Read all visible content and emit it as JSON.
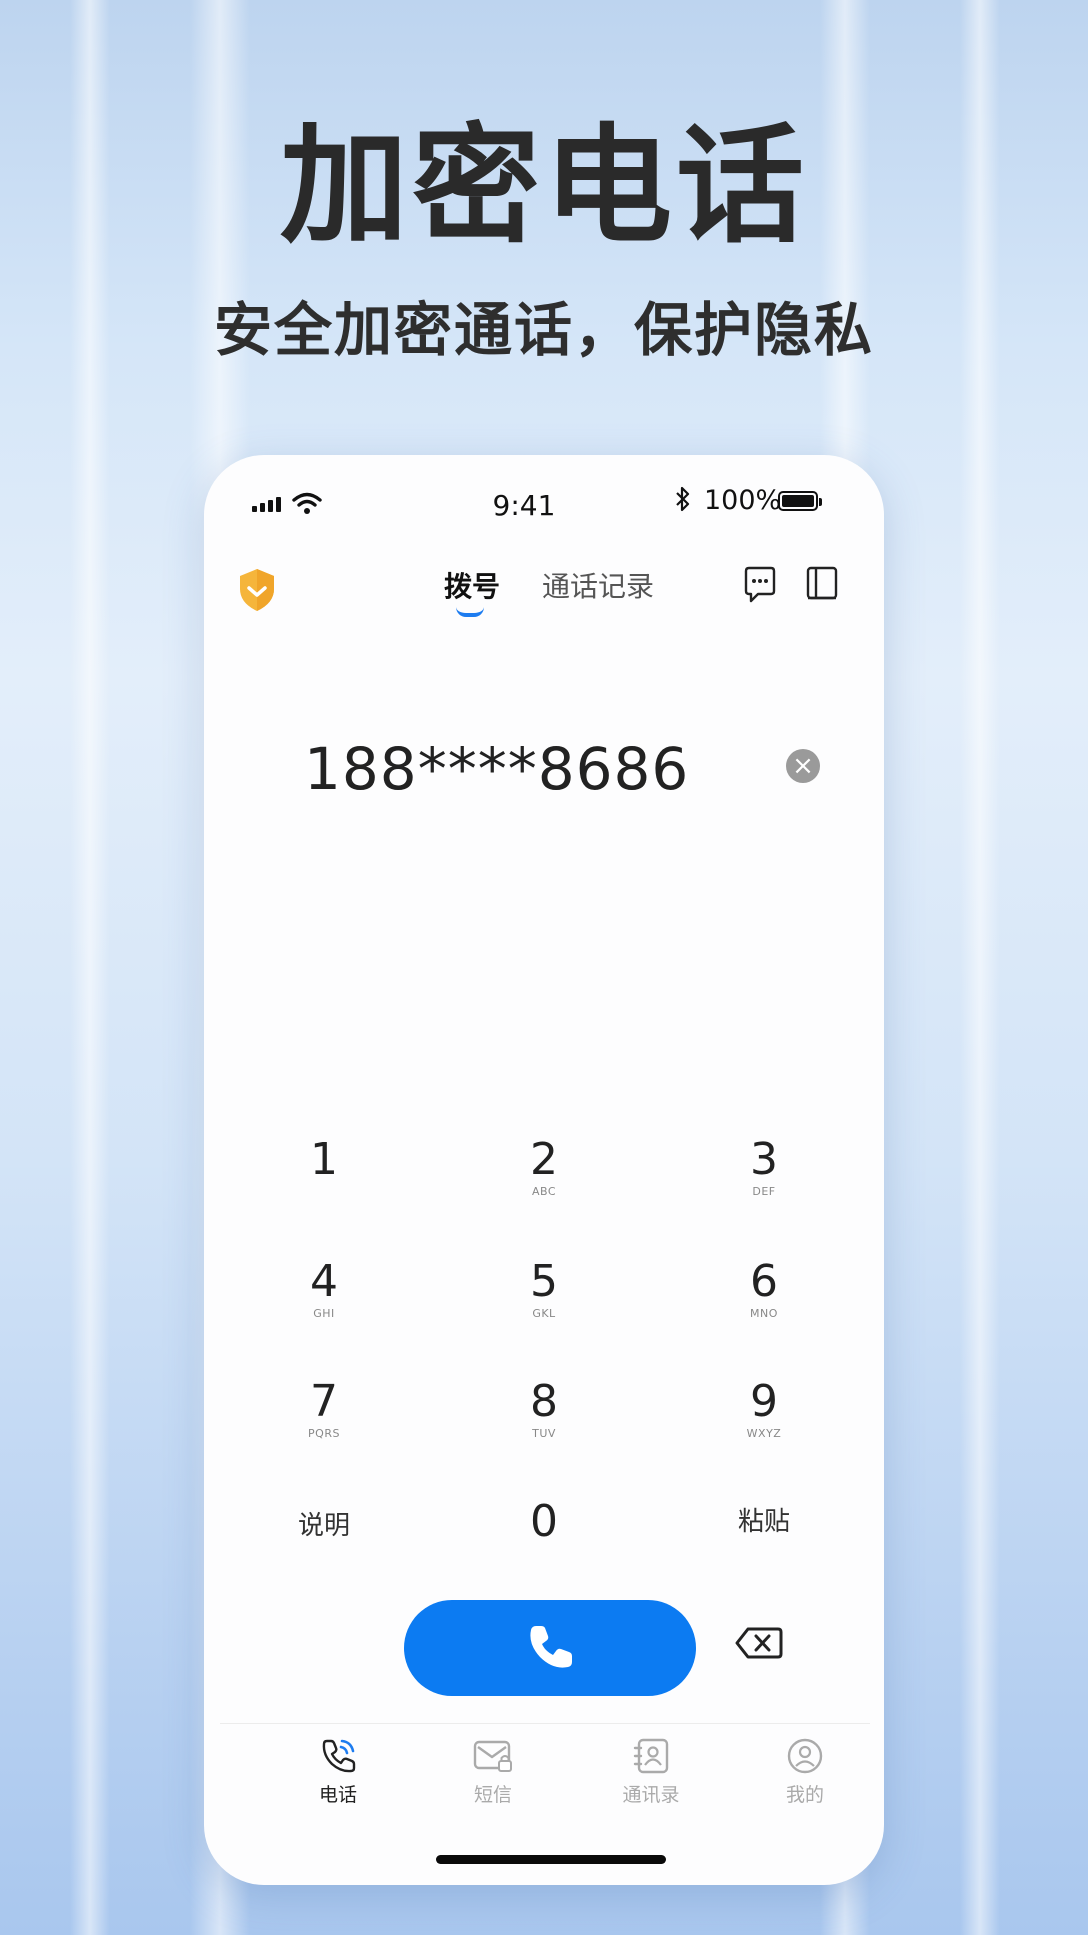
{
  "promo": {
    "title": "加密电话",
    "subtitle": "安全加密通话，保护隐私"
  },
  "status_bar": {
    "time": "9:41",
    "battery": "100%"
  },
  "header": {
    "tabs": [
      {
        "label": "拨号",
        "active": true
      },
      {
        "label": "通话记录",
        "active": false
      }
    ]
  },
  "dialer": {
    "number": "188****8686",
    "keys": [
      {
        "digit": "1",
        "letters": ""
      },
      {
        "digit": "2",
        "letters": "ABC"
      },
      {
        "digit": "3",
        "letters": "DEF"
      },
      {
        "digit": "4",
        "letters": "GHI"
      },
      {
        "digit": "5",
        "letters": "GKL"
      },
      {
        "digit": "6",
        "letters": "MNO"
      },
      {
        "digit": "7",
        "letters": "PQRS"
      },
      {
        "digit": "8",
        "letters": "TUV"
      },
      {
        "digit": "9",
        "letters": "WXYZ"
      }
    ],
    "bottom_row": {
      "left_label": "说明",
      "zero": "0",
      "right_label": "粘贴"
    }
  },
  "tabbar": {
    "items": [
      {
        "label": "电话",
        "icon": "phone-icon",
        "active": true
      },
      {
        "label": "短信",
        "icon": "sms-icon",
        "active": false
      },
      {
        "label": "通讯录",
        "icon": "contacts-icon",
        "active": false
      },
      {
        "label": "我的",
        "icon": "profile-icon",
        "active": false
      }
    ]
  },
  "colors": {
    "accent": "#0c7bf2",
    "shield": "#f5b53b"
  }
}
